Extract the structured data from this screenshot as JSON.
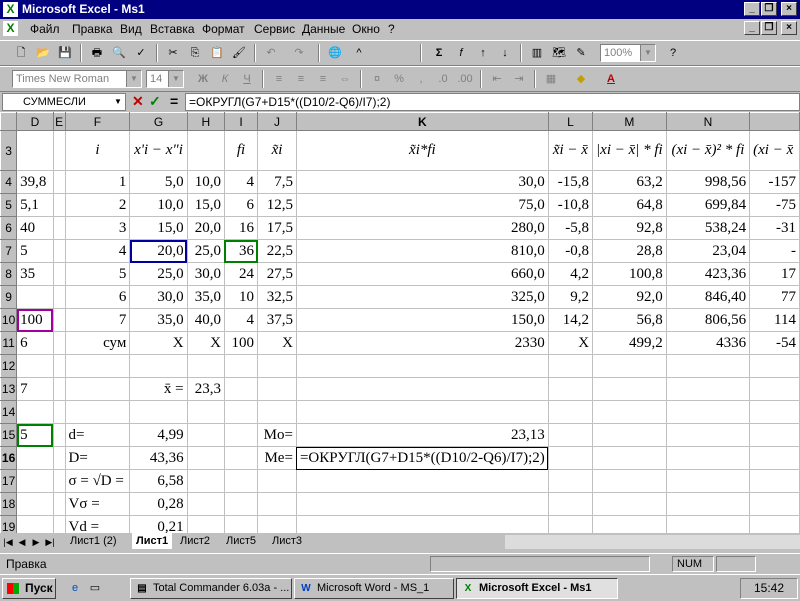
{
  "window": {
    "title": "Microsoft Excel - Ms1"
  },
  "menu": {
    "items": [
      "Файл",
      "Правка",
      "Вид",
      "Вставка",
      "Формат",
      "Сервис",
      "Данные",
      "Окно",
      "?"
    ]
  },
  "toolbar": {
    "zoom": "100%",
    "font": "Times New Roman",
    "font_size": "14"
  },
  "formula_bar": {
    "name_box": "СУММЕСЛИ",
    "formula": "=ОКРУГЛ(G7+D15*((D10/2-Q6)/I7);2)"
  },
  "columns": [
    "D",
    "E",
    "F",
    "G",
    "H",
    "I",
    "J",
    "K",
    "L",
    "M",
    "N",
    ""
  ],
  "rows": [
    {
      "n": "3",
      "cells": [
        "",
        "",
        "i",
        "x'i − x\"i",
        "",
        "fi",
        "x̃i",
        "x̃i*fi",
        "x̃i − x̄",
        "|xi − x̄| * fi",
        "(xi − x̄)² * fi",
        "(xi − x̄"
      ]
    },
    {
      "n": "4",
      "cells": [
        "39,8",
        "",
        "1",
        "5,0",
        "10,0",
        "4",
        "7,5",
        "30,0",
        "-15,8",
        "63,2",
        "998,56",
        "-157"
      ]
    },
    {
      "n": "5",
      "cells": [
        "5,1",
        "",
        "2",
        "10,0",
        "15,0",
        "6",
        "12,5",
        "75,0",
        "-10,8",
        "64,8",
        "699,84",
        "-75"
      ]
    },
    {
      "n": "6",
      "cells": [
        "40",
        "",
        "3",
        "15,0",
        "20,0",
        "16",
        "17,5",
        "280,0",
        "-5,8",
        "92,8",
        "538,24",
        "-31"
      ]
    },
    {
      "n": "7",
      "cells": [
        "5",
        "",
        "4",
        "20,0",
        "25,0",
        "36",
        "22,5",
        "810,0",
        "-0,8",
        "28,8",
        "23,04",
        "-"
      ]
    },
    {
      "n": "8",
      "cells": [
        "35",
        "",
        "5",
        "25,0",
        "30,0",
        "24",
        "27,5",
        "660,0",
        "4,2",
        "100,8",
        "423,36",
        "17"
      ]
    },
    {
      "n": "9",
      "cells": [
        "",
        "",
        "6",
        "30,0",
        "35,0",
        "10",
        "32,5",
        "325,0",
        "9,2",
        "92,0",
        "846,40",
        "77"
      ]
    },
    {
      "n": "10",
      "cells": [
        "100",
        "",
        "7",
        "35,0",
        "40,0",
        "4",
        "37,5",
        "150,0",
        "14,2",
        "56,8",
        "806,56",
        "114"
      ]
    },
    {
      "n": "11",
      "cells": [
        "6",
        "",
        "сум",
        "X",
        "X",
        "100",
        "X",
        "2330",
        "X",
        "499,2",
        "4336",
        "-54"
      ]
    },
    {
      "n": "12",
      "cells": [
        "",
        "",
        "",
        "",
        "",
        "",
        "",
        "",
        "",
        "",
        "",
        ""
      ]
    },
    {
      "n": "13",
      "cells": [
        "7",
        "",
        "",
        "x̄   =",
        "23,3",
        "",
        "",
        "",
        "",
        "",
        "",
        ""
      ]
    },
    {
      "n": "14",
      "cells": [
        "",
        "",
        "",
        "",
        "",
        "",
        "",
        "",
        "",
        "",
        "",
        ""
      ]
    },
    {
      "n": "15",
      "cells": [
        "5",
        "",
        "d=",
        "4,99",
        "",
        "",
        "Mo=",
        "23,13",
        "",
        "",
        "",
        ""
      ]
    },
    {
      "n": "16",
      "cells": [
        "",
        "",
        "D=",
        "43,36",
        "",
        "",
        "Me=",
        "=ОКРУГЛ(G7+D15*((D10/2-Q6)/I7);2)",
        "",
        "",
        "",
        ""
      ]
    },
    {
      "n": "17",
      "cells": [
        "",
        "",
        "σ = √D =",
        "6,58",
        "",
        "",
        "",
        "",
        "",
        "",
        "",
        ""
      ]
    },
    {
      "n": "18",
      "cells": [
        "",
        "",
        "Vσ =",
        "0,28",
        "",
        "",
        "",
        "",
        "",
        "",
        "",
        ""
      ]
    },
    {
      "n": "19",
      "cells": [
        "",
        "",
        "Vd =",
        "0,21",
        "",
        "",
        "",
        "",
        "",
        "",
        "",
        ""
      ]
    }
  ],
  "sheet_tabs": [
    "Лист1 (2)",
    "Лист1",
    "Лист2",
    "Лист5",
    "Лист3"
  ],
  "status": {
    "text": "Правка",
    "num": "NUM"
  },
  "taskbar": {
    "start": "Пуск",
    "items": [
      "Total Commander 6.03a - ...",
      "Microsoft Word - MS_1",
      "Microsoft Excel - Ms1"
    ],
    "clock": "15:42"
  }
}
